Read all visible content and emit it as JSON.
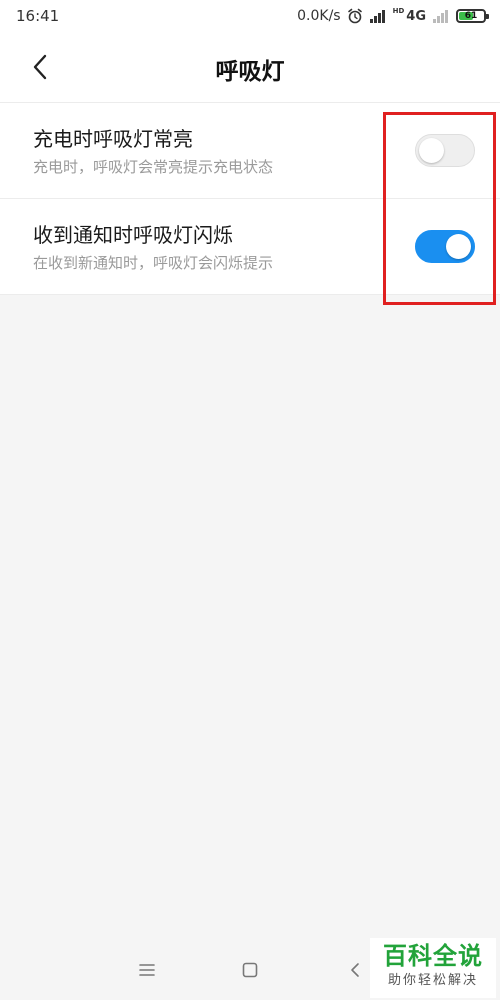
{
  "status_bar": {
    "time": "16:41",
    "net_speed": "0.0K/s",
    "hd_label": "HD",
    "network_type": "4G",
    "battery_level": "61",
    "icons": [
      "alarm-icon",
      "signal-icon",
      "signal-icon-weak",
      "battery-icon"
    ]
  },
  "header": {
    "title": "呼吸灯",
    "back_icon": "chevron-left-icon"
  },
  "settings": [
    {
      "title": "充电时呼吸灯常亮",
      "description": "充电时，呼吸灯会常亮提示充电状态",
      "enabled": false
    },
    {
      "title": "收到通知时呼吸灯闪烁",
      "description": "在收到新通知时，呼吸灯会闪烁提示",
      "enabled": true
    }
  ],
  "nav_bar": {
    "icons": [
      "menu-icon",
      "home-icon",
      "back-icon"
    ]
  },
  "watermark": {
    "brand": "百科全说",
    "slogan": "助你轻松解决"
  },
  "colors": {
    "accent": "#1a8ff0",
    "highlight": "#e02020",
    "watermark_green": "#22a33a",
    "background": "#f5f5f5"
  }
}
